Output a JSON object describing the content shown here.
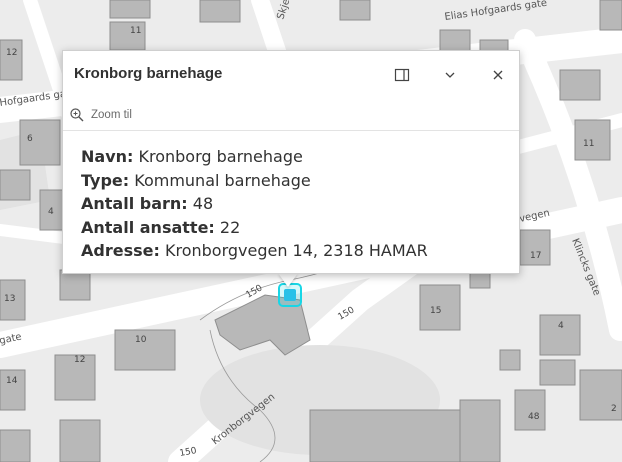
{
  "popup": {
    "title": "Kronborg barnehage",
    "zoom_label": "Zoom til",
    "icons": {
      "dock": "dock-icon",
      "collapse": "chevron-down-icon",
      "close": "close-icon",
      "zoom": "zoom-in-icon"
    },
    "attributes": [
      {
        "key": "Navn:",
        "value": "Kronborg barnehage"
      },
      {
        "key": "Type:",
        "value": "Kommunal barnehage"
      },
      {
        "key": "Antall barn:",
        "value": "48"
      },
      {
        "key": "Antall ansatte:",
        "value": "22"
      },
      {
        "key": "Adresse:",
        "value": "Kronborgvegen 14, 2318 HAMAR"
      }
    ]
  },
  "map": {
    "roads": {
      "elias": "Elias Hofgaards gate",
      "hofgaards_left": "Hofgaards gate",
      "gate_left": "gate",
      "skje": "Skje",
      "vegen": "vegen",
      "kronborgvegen": "Kronborgvegen",
      "klincks": "Klincks gate"
    },
    "house_numbers": {
      "n12a": "12",
      "n11a": "11",
      "n6": "6",
      "n4a": "4",
      "n13": "13",
      "n12b": "12",
      "n14": "14",
      "n10": "10",
      "n11b": "11",
      "n17": "17",
      "n15": "15",
      "n4b": "4",
      "n48": "48",
      "n2": "2"
    },
    "contours": {
      "c150a": "150",
      "c150b": "150",
      "c150c": "150"
    },
    "colors": {
      "background": "#ececec",
      "road": "#ffffff",
      "building": "#b8b8b8",
      "marker": "#18d6e6"
    },
    "marker_icon": "playground-icon"
  }
}
